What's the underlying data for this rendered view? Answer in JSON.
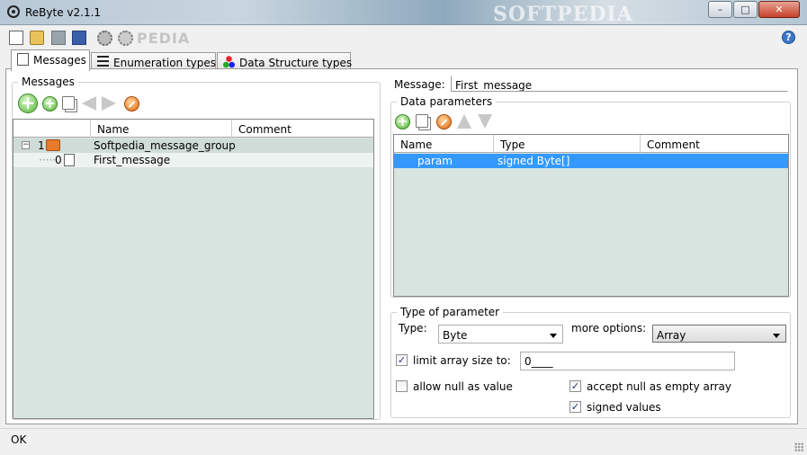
{
  "window": {
    "title": "ReByte v2.1.1",
    "watermark": "SOFTPEDIA",
    "controls": {
      "minimize": "–",
      "maximize": "□",
      "close": "✕"
    }
  },
  "toolbar": {
    "watermark": "PEDIA",
    "help_glyph": "?",
    "icons": [
      "new-file-icon",
      "open-folder-icon",
      "save-icon",
      "save-as-icon",
      "settings-icon",
      "settings-icon-2",
      "help-icon"
    ]
  },
  "tabs": [
    {
      "label": "Messages",
      "active": true
    },
    {
      "label": "Enumeration types",
      "active": false
    },
    {
      "label": "Data Structure types",
      "active": false
    }
  ],
  "messages": {
    "group_title": "Messages",
    "columns": [
      "Name",
      "Comment"
    ],
    "rows": [
      {
        "index": "1",
        "expander": "−",
        "name": "Softpedia_message_group",
        "comment": "",
        "type": "group"
      },
      {
        "index": "0",
        "name": "First_message",
        "comment": "",
        "type": "message"
      }
    ]
  },
  "message": {
    "label": "Message:",
    "value": "First_message"
  },
  "data_parameters": {
    "group_title": "Data parameters",
    "columns": [
      "Name",
      "Type",
      "Comment"
    ],
    "rows": [
      {
        "name": "param",
        "type": "signed Byte[]",
        "comment": "",
        "selected": true
      }
    ]
  },
  "type_of_parameter": {
    "group_title": "Type of parameter",
    "type_label": "Type:",
    "type_value": "Byte",
    "more_options_label": "more options:",
    "more_options_value": "Array",
    "limit_array_label": "limit array size to:",
    "limit_array_checked": true,
    "limit_array_value": "0____",
    "allow_null_label": "allow null as value",
    "allow_null_checked": false,
    "accept_null_label": "accept null as empty array",
    "accept_null_checked": true,
    "signed_values_label": "signed values",
    "signed_values_checked": true,
    "check_glyph": "✓"
  },
  "statusbar": {
    "text": "OK"
  }
}
